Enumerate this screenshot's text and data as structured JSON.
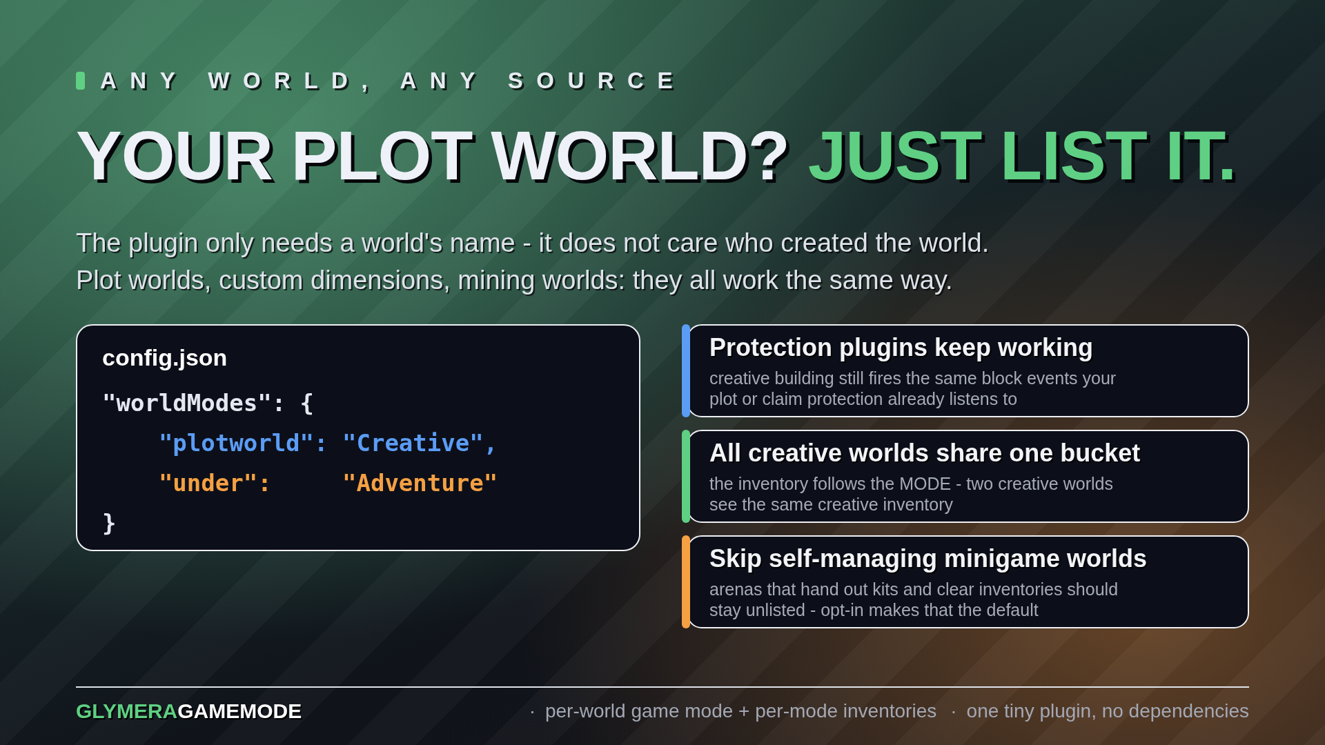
{
  "tagline": "ANY WORLD, ANY SOURCE",
  "title": {
    "text": "YOUR PLOT WORLD?",
    "highlight": "JUST LIST IT."
  },
  "intro": [
    "The plugin only needs a world's name - it does not care who created the world.",
    "Plot worlds, custom dimensions, mining worlds: they all work the same way."
  ],
  "code_card": {
    "filename": "config.json",
    "opening": "\"worldModes\": {",
    "entries": [
      {
        "key": "\"plotworld\":",
        "value": "\"Creative\",",
        "color": "#5b9cf5"
      },
      {
        "key": "\"under\":",
        "value": "\"Adventure\"",
        "color": "#f5a043"
      }
    ],
    "closing": "}"
  },
  "features": [
    {
      "title": "Protection plugins keep working",
      "description": "creative building still fires the same block events your plot or claim protection already listens to",
      "color": "#5b9cf5"
    },
    {
      "title": "All creative worlds share one bucket",
      "description": "the inventory follows the MODE - two creative worlds see the same creative inventory",
      "color": "#5fd083"
    },
    {
      "title": "Skip self-managing minigame worlds",
      "description": "arenas that hand out kits and clear inventories should stay unlisted - opt-in makes that the default",
      "color": "#f5a043"
    }
  ],
  "footer": {
    "brand": {
      "accent": "GLYMERA",
      "name": "GAMEMODE"
    },
    "tags": [
      {
        "separator": "·",
        "text": "per-world game mode + per-mode inventories"
      },
      {
        "separator": "·",
        "text": "one tiny plugin, no dependencies"
      }
    ]
  }
}
